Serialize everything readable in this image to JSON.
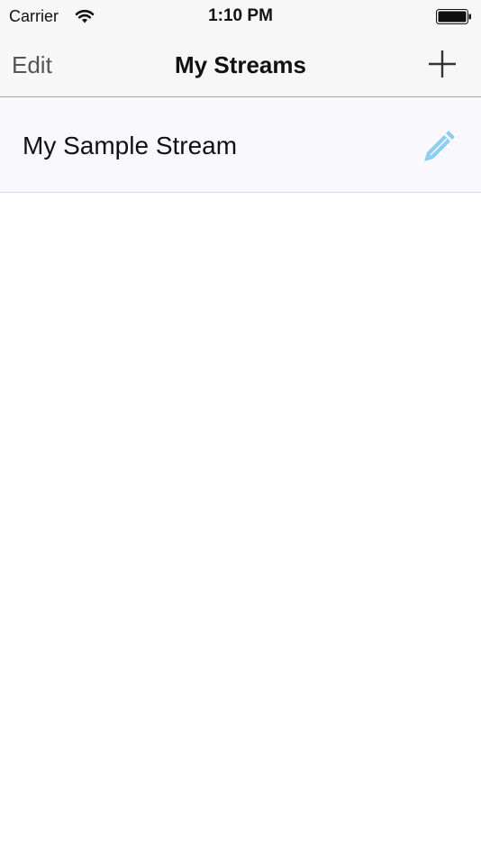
{
  "status_bar": {
    "carrier": "Carrier",
    "time": "1:10 PM",
    "wifi_icon": "wifi-icon",
    "battery_icon": "battery-icon"
  },
  "nav_bar": {
    "edit_label": "Edit",
    "title": "My Streams",
    "add_icon": "plus-icon"
  },
  "streams": [
    {
      "name": "My Sample Stream",
      "edit_icon": "pencil-icon"
    }
  ],
  "colors": {
    "bar_background": "#f7f7f7",
    "row_background": "#f8f8fd",
    "pencil_accent": "#8ccdf2",
    "edit_text": "#555555"
  }
}
